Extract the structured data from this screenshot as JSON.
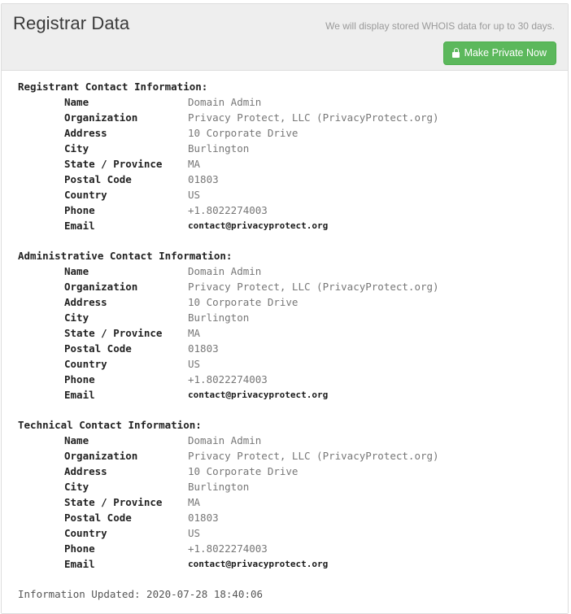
{
  "header": {
    "title": "Registrar Data",
    "note": "We will display stored WHOIS data for up to 30 days.",
    "make_private_label": "Make Private Now",
    "lock_icon": "lock-icon",
    "button_color": "#5cb85c",
    "background_color": "#eeeeee"
  },
  "sections": [
    {
      "title": "Registrant Contact Information:",
      "fields": [
        {
          "label": "Name",
          "value": "Domain Admin",
          "kind": "text"
        },
        {
          "label": "Organization",
          "value": "Privacy Protect, LLC (PrivacyProtect.org)",
          "kind": "text"
        },
        {
          "label": "Address",
          "value": "10 Corporate Drive",
          "kind": "text"
        },
        {
          "label": "City",
          "value": "Burlington",
          "kind": "text"
        },
        {
          "label": "State / Province",
          "value": "MA",
          "kind": "text"
        },
        {
          "label": "Postal Code",
          "value": "01803",
          "kind": "text"
        },
        {
          "label": "Country",
          "value": "US",
          "kind": "text"
        },
        {
          "label": "Phone",
          "value": "+1.8022274003",
          "kind": "text"
        },
        {
          "label": "Email",
          "value": "contact@privacyprotect.org",
          "kind": "email"
        }
      ]
    },
    {
      "title": "Administrative Contact Information:",
      "fields": [
        {
          "label": "Name",
          "value": "Domain Admin",
          "kind": "text"
        },
        {
          "label": "Organization",
          "value": "Privacy Protect, LLC (PrivacyProtect.org)",
          "kind": "text"
        },
        {
          "label": "Address",
          "value": "10 Corporate Drive",
          "kind": "text"
        },
        {
          "label": "City",
          "value": "Burlington",
          "kind": "text"
        },
        {
          "label": "State / Province",
          "value": "MA",
          "kind": "text"
        },
        {
          "label": "Postal Code",
          "value": "01803",
          "kind": "text"
        },
        {
          "label": "Country",
          "value": "US",
          "kind": "text"
        },
        {
          "label": "Phone",
          "value": "+1.8022274003",
          "kind": "text"
        },
        {
          "label": "Email",
          "value": "contact@privacyprotect.org",
          "kind": "email"
        }
      ]
    },
    {
      "title": "Technical Contact Information:",
      "fields": [
        {
          "label": "Name",
          "value": "Domain Admin",
          "kind": "text"
        },
        {
          "label": "Organization",
          "value": "Privacy Protect, LLC (PrivacyProtect.org)",
          "kind": "text"
        },
        {
          "label": "Address",
          "value": "10 Corporate Drive",
          "kind": "text"
        },
        {
          "label": "City",
          "value": "Burlington",
          "kind": "text"
        },
        {
          "label": "State / Province",
          "value": "MA",
          "kind": "text"
        },
        {
          "label": "Postal Code",
          "value": "01803",
          "kind": "text"
        },
        {
          "label": "Country",
          "value": "US",
          "kind": "text"
        },
        {
          "label": "Phone",
          "value": "+1.8022274003",
          "kind": "text"
        },
        {
          "label": "Email",
          "value": "contact@privacyprotect.org",
          "kind": "email"
        }
      ]
    }
  ],
  "footer": {
    "updated": "Information Updated: 2020-07-28 18:40:06"
  }
}
